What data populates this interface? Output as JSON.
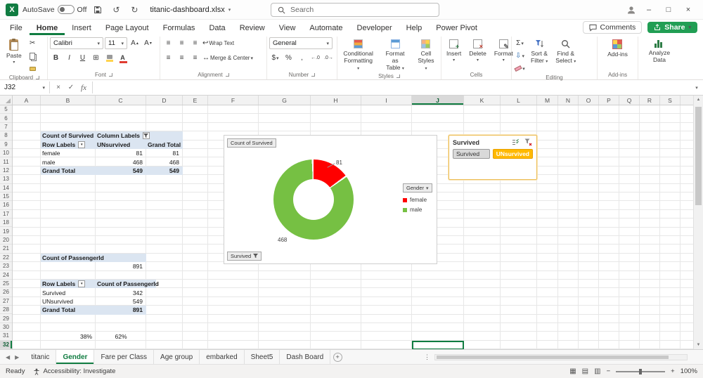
{
  "titlebar": {
    "app_initial": "X",
    "autosave_label": "AutoSave",
    "autosave_state": "Off",
    "filename": "titanic-dashboard.xlsx",
    "search_placeholder": "Search"
  },
  "ribbon_tabs": [
    {
      "label": "File"
    },
    {
      "label": "Home",
      "active": true
    },
    {
      "label": "Insert"
    },
    {
      "label": "Page Layout"
    },
    {
      "label": "Formulas"
    },
    {
      "label": "Data"
    },
    {
      "label": "Review"
    },
    {
      "label": "View"
    },
    {
      "label": "Automate"
    },
    {
      "label": "Developer"
    },
    {
      "label": "Help"
    },
    {
      "label": "Power Pivot"
    }
  ],
  "ribbon_right": {
    "comments": "Comments",
    "share": "Share"
  },
  "ribbon": {
    "clipboard": {
      "group": "Clipboard",
      "paste": "Paste"
    },
    "font": {
      "group": "Font",
      "name": "Calibri",
      "size": "11",
      "bold": "B",
      "italic": "I",
      "underline": "U"
    },
    "alignment": {
      "group": "Alignment",
      "wrap": "Wrap Text",
      "merge": "Merge & Center"
    },
    "number": {
      "group": "Number",
      "format": "General"
    },
    "styles": {
      "group": "Styles",
      "cond1": "Conditional",
      "cond2": "Formatting",
      "fmt1": "Format as",
      "fmt2": "Table",
      "cell1": "Cell",
      "cell2": "Styles"
    },
    "cells": {
      "group": "Cells",
      "insert": "Insert",
      "delete": "Delete",
      "format": "Format"
    },
    "editing": {
      "group": "Editing",
      "sort1": "Sort &",
      "sort2": "Filter",
      "find1": "Find &",
      "find2": "Select"
    },
    "addins": {
      "group": "Add-ins",
      "label": "Add-ins"
    },
    "analyze": {
      "label1": "Analyze",
      "label2": "Data"
    }
  },
  "icons": {
    "dropdown": "▾",
    "cut": "✂",
    "undo": "↺",
    "redo": "↻",
    "minimize": "–",
    "maximize": "□",
    "close": "×",
    "cancel": "×",
    "check": "✓",
    "fx": "fx",
    "borders": "⊞",
    "align": "≡",
    "wrap": "↩",
    "merge": "↔",
    "sigma": "Σ",
    "fill_down": "⇩",
    "pencil": "✎",
    "currency": "$",
    "percent": "%",
    "comma": ",",
    "inc_decimal": "←.0",
    "dec_decimal": ".0→",
    "nav_left": "◀",
    "nav_right": "▶",
    "add_sheet": "+",
    "vdots": "⋮",
    "view_normal": "▦",
    "view_layout": "▤",
    "view_break": "▥",
    "zoom_out": "−",
    "zoom_in": "+"
  },
  "formula_bar": {
    "name_box": "J32",
    "formula": ""
  },
  "grid": {
    "columns": [
      "A",
      "B",
      "C",
      "D",
      "E",
      "F",
      "G",
      "H",
      "I",
      "J",
      "K",
      "L",
      "M",
      "N",
      "O",
      "P",
      "Q",
      "R",
      "S"
    ],
    "selected_column": "J",
    "row_start": 5,
    "row_end": 32,
    "selected_row": 32,
    "selected_cell": "J32"
  },
  "pivot_survived": {
    "title": "Count of Survived",
    "column_labels": "Column Labels",
    "row_labels": "Row Labels",
    "col1": "UNsurvived",
    "col2": "Grand Total",
    "rows": [
      {
        "label": "female",
        "v1": "81",
        "v2": "81"
      },
      {
        "label": "male",
        "v1": "468",
        "v2": "468"
      }
    ],
    "total_label": "Grand Total",
    "total_v1": "549",
    "total_v2": "549"
  },
  "pivot_passengers": {
    "title": "Count of PassengerId",
    "value": "891"
  },
  "pivot_summary": {
    "row_labels": "Row Labels",
    "value_header": "Count of PassengerId",
    "rows": [
      {
        "label": "Survived",
        "value": "342"
      },
      {
        "label": "UNsurvived",
        "value": "549"
      }
    ],
    "total_label": "Grand Total",
    "total_value": "891"
  },
  "percent_row": {
    "survived_pct": "38%",
    "unsurvived_pct": "62%"
  },
  "chart_data": {
    "type": "pie",
    "subtype": "doughnut",
    "title": "Count of Survived",
    "value_button": "Count of Survived",
    "legend_button": "Gender",
    "axis_button": "Survived",
    "categories": [
      "female",
      "male"
    ],
    "values": [
      81,
      468
    ],
    "data_labels": [
      "81",
      "468"
    ],
    "colors": [
      "#ff0000",
      "#76c043"
    ],
    "legend_position": "right"
  },
  "slicer": {
    "title": "Survived",
    "items": [
      {
        "label": "Survived",
        "selected": false
      },
      {
        "label": "UNsurvived",
        "selected": true
      }
    ]
  },
  "sheet_bar": {
    "tabs": [
      {
        "label": "titanic"
      },
      {
        "label": "Gender",
        "active": true
      },
      {
        "label": "Fare per Class"
      },
      {
        "label": "Age group"
      },
      {
        "label": "embarked"
      },
      {
        "label": "Sheet5"
      },
      {
        "label": "Dash Board"
      }
    ]
  },
  "status_bar": {
    "ready": "Ready",
    "accessibility": "Accessibility: Investigate",
    "zoom": "100%"
  },
  "colors": {
    "excel_green": "#107c41",
    "share_button": "#219e54",
    "pivot_header_bg": "#dbe5f1",
    "donut_female": "#ff0000",
    "donut_male": "#76c043",
    "slicer_selected": "#ffb900"
  }
}
